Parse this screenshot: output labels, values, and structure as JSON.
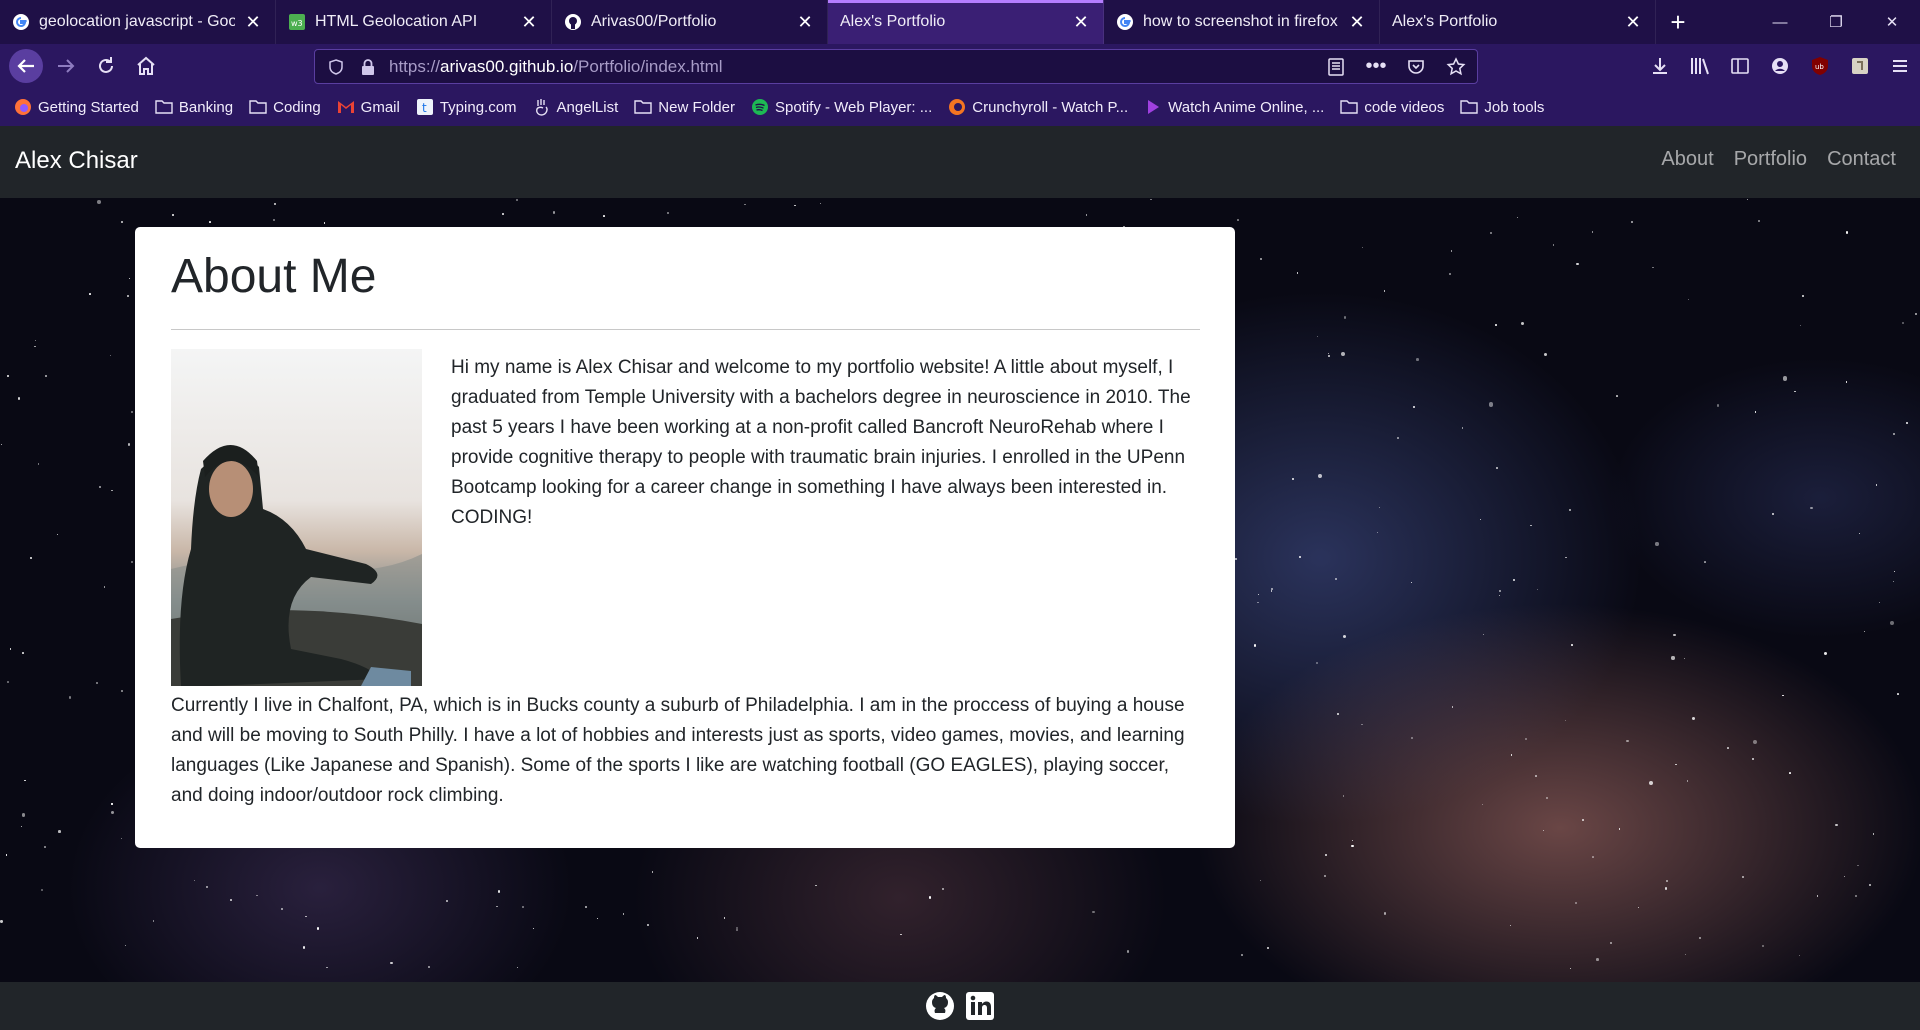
{
  "browser": {
    "tabs": [
      {
        "label": "geolocation javascript - Goog",
        "icon": "google-icon"
      },
      {
        "label": "HTML Geolocation API",
        "icon": "w3schools-icon"
      },
      {
        "label": "Arivas00/Portfolio",
        "icon": "github-icon"
      },
      {
        "label": "Alex's Portfolio",
        "icon": "none",
        "active": true
      },
      {
        "label": "how to screenshot in firefox br",
        "icon": "google-icon"
      },
      {
        "label": "Alex's Portfolio",
        "icon": "none"
      }
    ],
    "url": {
      "scheme": "https://",
      "domain": "arivas00.github.io",
      "path": "/Portfolio/index.html"
    },
    "bookmarks": [
      {
        "label": "Getting Started",
        "icon": "firefox-icon"
      },
      {
        "label": "Banking",
        "icon": "folder-icon"
      },
      {
        "label": "Coding",
        "icon": "folder-icon"
      },
      {
        "label": "Gmail",
        "icon": "gmail-icon"
      },
      {
        "label": "Typing.com",
        "icon": "typing-icon"
      },
      {
        "label": "AngelList",
        "icon": "angellist-icon"
      },
      {
        "label": "New Folder",
        "icon": "folder-icon"
      },
      {
        "label": "Spotify - Web Player: ...",
        "icon": "spotify-icon"
      },
      {
        "label": "Crunchyroll - Watch P...",
        "icon": "crunchyroll-icon"
      },
      {
        "label": "Watch Anime Online, ...",
        "icon": "play-icon"
      },
      {
        "label": "code videos",
        "icon": "folder-icon"
      },
      {
        "label": "Job tools",
        "icon": "folder-icon"
      }
    ],
    "colors": {
      "accent": "#b57dff",
      "tabbar": "#1f1047",
      "toolbar": "#2b1760"
    }
  },
  "site": {
    "brand": "Alex Chisar",
    "nav": [
      "About",
      "Portfolio",
      "Contact"
    ],
    "about": {
      "title": "About Me",
      "paragraph1": "Hi my name is Alex Chisar and welcome to my portfolio website! A little about myself, I graduated from Temple University with a bachelors degree in neuroscience in 2010. The past 5 years I have been working at a non-profit called Bancroft NeuroRehab where I provide cognitive therapy to people with traumatic brain injuries. I enrolled in the UPenn Bootcamp looking for a career change in something I have always been interested in. CODING!",
      "paragraph2": "Currently I live in Chalfont, PA, which is in Bucks county a suburb of Philadelphia. I am in the proccess of buying a house and will be moving to South Philly. I have a lot of hobbies and interests just as sports, video games, movies, and learning languages (Like Japanese and Spanish). Some of the sports I like are watching football (GO EAGLES), playing soccer, and doing indoor/outdoor rock climbing."
    },
    "footer_icons": [
      "github-icon",
      "linkedin-icon"
    ],
    "colors": {
      "navbar": "#212529",
      "text": "#212529",
      "card": "#ffffff"
    }
  }
}
